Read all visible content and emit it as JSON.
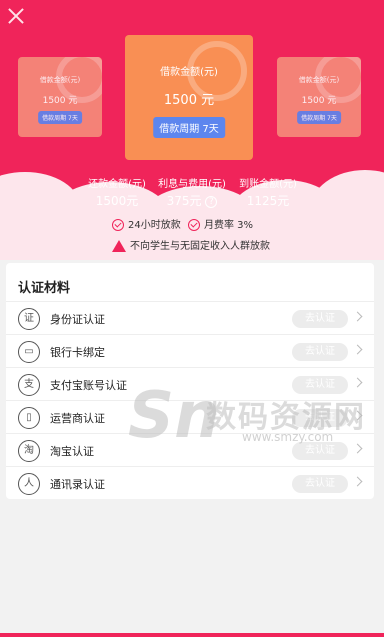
{
  "loan_cards": {
    "left": {
      "label": "借款金额(元)",
      "amount": "1500 元",
      "period": "借款周期 7天"
    },
    "center": {
      "label": "借款金额(元)",
      "amount": "1500 元",
      "period": "借款周期 7天"
    },
    "right": {
      "label": "借款金额(元)",
      "amount": "1500 元",
      "period": "借款周期 7天"
    }
  },
  "stats": [
    {
      "label": "还款金额(元)",
      "value": "1500元"
    },
    {
      "label": "利息与费用(元)",
      "value": "375元"
    },
    {
      "label": "到账金额(元)",
      "value": "1125元"
    }
  ],
  "stats_help": "?",
  "notes": {
    "fast": "24小时放款",
    "rate": "月费率 3%",
    "warning": "不向学生与无固定收入人群放款"
  },
  "certification": {
    "title": "认证材料",
    "items": [
      {
        "icon_char": "证",
        "label": "身份证认证",
        "action": "去认证",
        "icon": "id-card-icon"
      },
      {
        "icon_char": "▭",
        "label": "银行卡绑定",
        "action": "去认证",
        "icon": "bank-card-icon"
      },
      {
        "icon_char": "支",
        "label": "支付宝账号认证",
        "action": "去认证",
        "icon": "alipay-icon"
      },
      {
        "icon_char": "▯",
        "label": "运营商认证",
        "action": "去认证",
        "icon": "phone-carrier-icon"
      },
      {
        "icon_char": "淘",
        "label": "淘宝认证",
        "action": "去认证",
        "icon": "taobao-icon"
      },
      {
        "icon_char": "人",
        "label": "通讯录认证",
        "action": "去认证",
        "icon": "contacts-icon"
      }
    ]
  },
  "watermark": {
    "mark": "Sn",
    "name": "数码资源网",
    "url": "www.smzy.com"
  },
  "colors": {
    "primary": "#f0245a",
    "card": "#f98f54",
    "pill": "#5d86ee"
  }
}
